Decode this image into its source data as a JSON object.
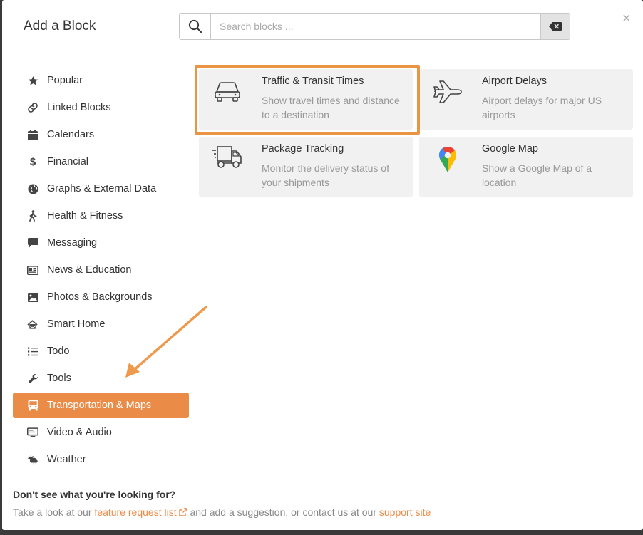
{
  "header": {
    "title": "Add a Block",
    "search_placeholder": "Search blocks ...",
    "search_value": "",
    "close_label": "×"
  },
  "sidebar": {
    "items": [
      {
        "label": "Popular",
        "icon": "star-icon"
      },
      {
        "label": "Linked Blocks",
        "icon": "link-icon"
      },
      {
        "label": "Calendars",
        "icon": "calendar-icon"
      },
      {
        "label": "Financial",
        "icon": "dollar-icon"
      },
      {
        "label": "Graphs & External Data",
        "icon": "globe-icon"
      },
      {
        "label": "Health & Fitness",
        "icon": "walking-icon"
      },
      {
        "label": "Messaging",
        "icon": "message-icon"
      },
      {
        "label": "News & Education",
        "icon": "newspaper-icon"
      },
      {
        "label": "Photos & Backgrounds",
        "icon": "image-icon"
      },
      {
        "label": "Smart Home",
        "icon": "smart-home-icon"
      },
      {
        "label": "Todo",
        "icon": "list-icon"
      },
      {
        "label": "Tools",
        "icon": "wrench-icon"
      },
      {
        "label": "Transportation & Maps",
        "icon": "bus-icon",
        "active": true
      },
      {
        "label": "Video & Audio",
        "icon": "monitor-icon"
      },
      {
        "label": "Weather",
        "icon": "weather-icon"
      }
    ]
  },
  "blocks": [
    {
      "title": "Traffic & Transit Times",
      "desc": "Show travel times and distance to a destination",
      "icon": "car-icon",
      "highlighted": true
    },
    {
      "title": "Airport Delays",
      "desc": "Airport delays for major US airports",
      "icon": "airplane-icon"
    },
    {
      "title": "Package Tracking",
      "desc": "Monitor the delivery status of your shipments",
      "icon": "delivery-truck-icon"
    },
    {
      "title": "Google Map",
      "desc": "Show a Google Map of a location",
      "icon": "map-pin-icon"
    }
  ],
  "footer": {
    "question": "Don't see what you're looking for?",
    "text_1": "Take a look at our ",
    "link_1": "feature request list",
    "text_2": " and add a suggestion, or contact us at our ",
    "link_2": "support site"
  },
  "colors": {
    "accent": "#ea8c48",
    "card_bg": "#f1f1f1",
    "highlight_border": "#ea9544"
  }
}
